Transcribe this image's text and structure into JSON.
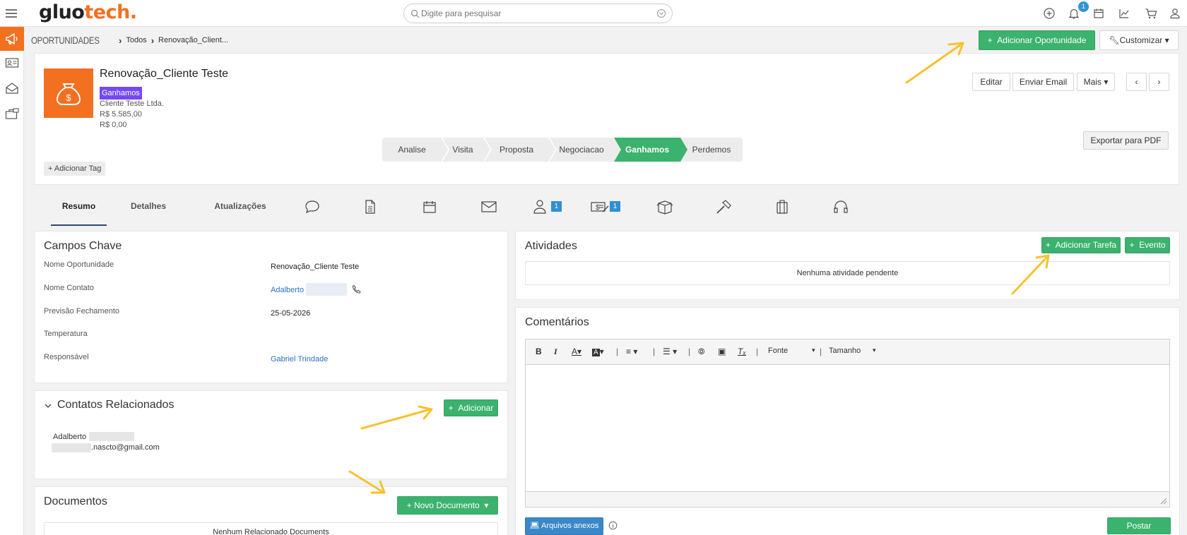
{
  "brand": {
    "logo_prefix": "gluo",
    "logo_suffix": "tech",
    "logo_dot": "."
  },
  "search": {
    "placeholder": "Digite para pesquisar"
  },
  "topbar": {
    "notification_count": "1"
  },
  "breadcrumb": {
    "root": "OPORTUNIDADES",
    "level1": "Todos",
    "current": "Renovação_Client..."
  },
  "actions": {
    "add_opportunity": "Adicionar Oportunidade",
    "customize": "Customizar"
  },
  "record": {
    "title": "Renovação_Cliente Teste",
    "stage_badge": "Ganhamos",
    "company": "Cliente Teste Ltda.",
    "amount": "R$ 5.585,00",
    "amount2": "R$ 0,00",
    "buttons": {
      "edit": "Editar",
      "send_email": "Enviar Email",
      "more": "Mais",
      "export_pdf": "Exportar para PDF"
    },
    "add_tag": "Adicionar Tag"
  },
  "pipeline": {
    "steps": [
      "Analise",
      "Visita",
      "Proposta",
      "Negociacao",
      "Ganhamos",
      "Perdemos"
    ],
    "active": "Ganhamos"
  },
  "tabs": {
    "summary": "Resumo",
    "details": "Detalhes",
    "updates": "Atualizações",
    "contacts_badge": "1",
    "quotes_badge": "1"
  },
  "key_fields": {
    "title": "Campos Chave",
    "rows": [
      {
        "label": "Nome Oportunidade",
        "value": "Renovação_Cliente Teste"
      },
      {
        "label": "Nome Contato",
        "value": "Adalberto"
      },
      {
        "label": "Previsão Fechamento",
        "value": "25-05-2026"
      },
      {
        "label": "Temperatura",
        "value": ""
      },
      {
        "label": "Responsável",
        "value": "Gabriel Trindade"
      }
    ]
  },
  "related_contacts": {
    "title": "Contatos Relacionados",
    "add": "Adicionar",
    "contact_name": "Adalberto",
    "contact_email": ".nascto@gmail.com"
  },
  "documents": {
    "title": "Documentos",
    "new": "Novo Documento",
    "empty": "Nenhum Relacionado Documents"
  },
  "activities": {
    "title": "Atividades",
    "add_task": "Adicionar Tarefa",
    "event": "Evento",
    "empty": "Nenhuma atividade pendente"
  },
  "comments": {
    "title": "Comentários",
    "font": "Fonte",
    "size": "Tamanho",
    "attachments": "Arquivos anexos",
    "post": "Postar"
  },
  "colors": {
    "brand_orange": "#f37021",
    "green": "#3bb26d",
    "badge_purple": "#7449f5",
    "link_blue": "#2a6fc9",
    "annotation_arrow": "#f7c230"
  }
}
